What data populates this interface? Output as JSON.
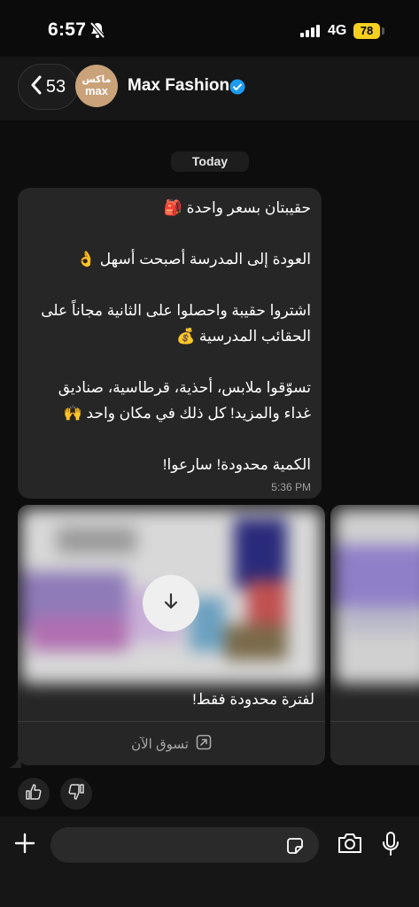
{
  "status": {
    "time": "6:57",
    "network": "4G",
    "battery": "78"
  },
  "header": {
    "back_count": "53",
    "avatar_ar": "ماكس",
    "avatar_en": "max",
    "title": "Max Fashion"
  },
  "chat": {
    "date": "Today",
    "message": {
      "text": "حقيبتان بسعر واحدة 🎒\n\nالعودة إلى المدرسة أصبحت أسهل 👌\n\nاشتروا حقيبة واحصلوا على الثانية مجاناً على الحقائب المدرسية 💰\n\nتسوّقوا ملابس، أحذية، قرطاسية، صناديق غداء والمزيد! كل ذلك في مكان واحد 🙌\n\nالكمية محدودة! سارعوا!",
      "time": "5:36 PM"
    },
    "card": {
      "caption": "لفترة محدودة فقط!",
      "cta": "تسوق الآن"
    }
  },
  "composer": {
    "placeholder": ""
  },
  "colors": {
    "accent": "#f5d020",
    "verified": "#1d9bf0",
    "avatar_bg": "#c9a27a",
    "bubble": "#262626"
  },
  "icons": [
    "bell-slash-icon",
    "signal-icon",
    "chevron-left-icon",
    "verified-icon",
    "download-icon",
    "external-link-icon",
    "thumbs-up-icon",
    "thumbs-down-icon",
    "plus-icon",
    "sticker-icon",
    "camera-icon",
    "mic-icon"
  ]
}
